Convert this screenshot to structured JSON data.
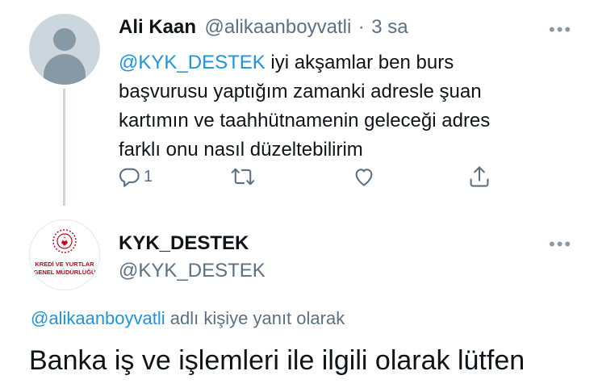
{
  "tweet1": {
    "author_name": "Ali Kaan",
    "author_handle": "@alikaanboyvatli",
    "separator": "·",
    "time": "3 sa",
    "more": "•••",
    "mention": "@KYK_DESTEK",
    "text_line1_rest": " iyi akşamlar ben burs",
    "text_line2": "başvurusu yaptığım zamanki adresle şuan",
    "text_line3": "kartımın ve taahhütnamenin geleceği  adres",
    "text_line4": "farklı onu nasıl düzeltebilirim",
    "reply_count": "1",
    "icons": [
      "reply-icon",
      "retweet-icon",
      "like-icon",
      "share-icon"
    ]
  },
  "tweet2": {
    "author_name": "KYK_DESTEK",
    "author_handle": "@KYK_DESTEK",
    "more": "•••",
    "logo_line1": "KREDİ VE YURTLAR",
    "logo_line2": "GENEL MÜDÜRLÜĞÜ",
    "reply_to_handle": "@alikaanboyvatli",
    "reply_to_text": " adlı kişiye yanıt olarak",
    "text": "Banka iş ve işlemleri ile ilgili olarak lütfen"
  },
  "colors": {
    "link": "#1b95e0",
    "muted": "#5b7083",
    "logo_red": "#d0021b"
  }
}
